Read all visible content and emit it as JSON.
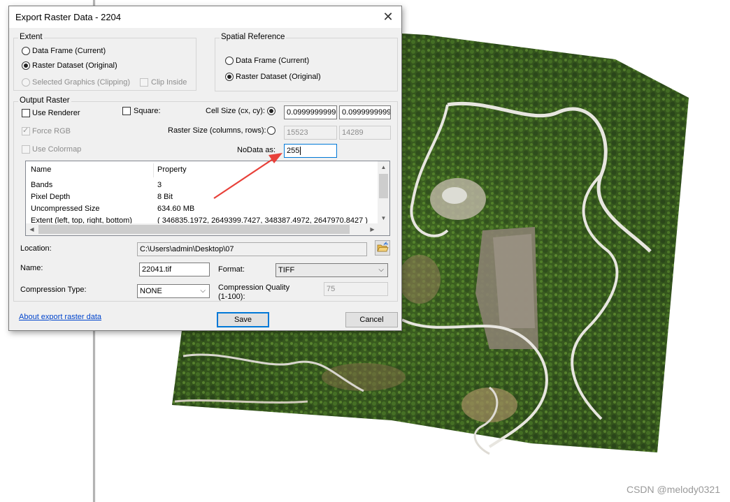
{
  "dialog": {
    "title": "Export Raster Data - 2204",
    "extent": {
      "legend": "Extent",
      "data_frame": "Data Frame (Current)",
      "raster_dataset": "Raster Dataset (Original)",
      "selected_graphics": "Selected Graphics (Clipping)",
      "clip_inside": "Clip Inside"
    },
    "spatial_reference": {
      "legend": "Spatial Reference",
      "data_frame": "Data Frame (Current)",
      "raster_dataset": "Raster Dataset (Original)"
    },
    "output_raster": {
      "legend": "Output Raster",
      "use_renderer": "Use Renderer",
      "square": "Square:",
      "force_rgb": "Force RGB",
      "use_colormap": "Use Colormap",
      "cell_size_label": "Cell Size (cx, cy):",
      "cell_size_cx": "0.0999999999",
      "cell_size_cy": "0.0999999999",
      "raster_size_label": "Raster Size (columns, rows):",
      "columns": "15523",
      "rows": "14289",
      "nodata_label": "NoData as:",
      "nodata_value": "255"
    },
    "properties": {
      "col_name": "Name",
      "col_property": "Property",
      "rows": [
        {
          "name": "Bands",
          "value": "3"
        },
        {
          "name": "Pixel Depth",
          "value": "8 Bit"
        },
        {
          "name": "Uncompressed Size",
          "value": "634.60 MB"
        },
        {
          "name": "Extent (left, top, right, bottom)",
          "value": "( 346835.1972, 2649399.7427, 348387.4972, 2647970.8427 )"
        }
      ]
    },
    "location_label": "Location:",
    "location_value": "C:\\Users\\admin\\Desktop\\07",
    "name_label": "Name:",
    "name_value": "22041.tif",
    "format_label": "Format:",
    "format_value": "TIFF",
    "compression_type_label": "Compression Type:",
    "compression_type_value": "NONE",
    "compression_quality_label_1": "Compression Quality",
    "compression_quality_label_2": "(1-100):",
    "compression_quality_value": "75",
    "about_link": "About export raster data",
    "save_label": "Save",
    "cancel_label": "Cancel"
  },
  "watermark": "CSDN @melody0321",
  "colors": {
    "arrow": "#e8413a",
    "accent": "#0078d7",
    "link": "#0044cc"
  }
}
